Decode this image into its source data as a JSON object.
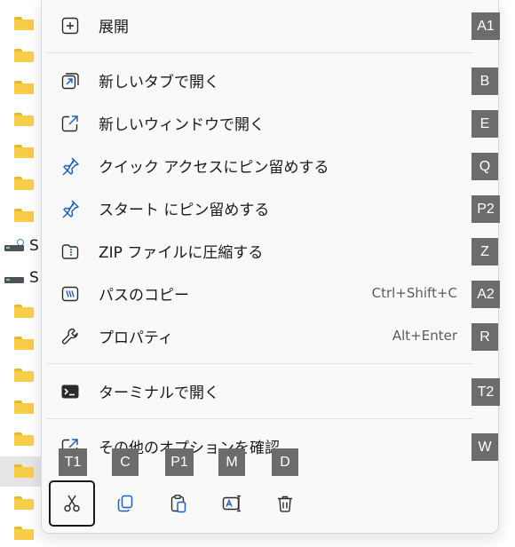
{
  "menu": {
    "items": [
      {
        "label": "展開",
        "shortcut": "",
        "icon": "expand-icon"
      },
      {
        "label": "新しいタブで開く",
        "shortcut": "",
        "icon": "new-tab-icon"
      },
      {
        "label": "新しいウィンドウで開く",
        "shortcut": "",
        "icon": "new-window-icon"
      },
      {
        "label": "クイック アクセスにピン留めする",
        "shortcut": "",
        "icon": "pin-icon"
      },
      {
        "label": "スタート にピン留めする",
        "shortcut": "",
        "icon": "pin-icon"
      },
      {
        "label": "ZIP ファイルに圧縮する",
        "shortcut": "",
        "icon": "zip-icon"
      },
      {
        "label": "パスのコピー",
        "shortcut": "Ctrl+Shift+C",
        "icon": "copy-path-icon"
      },
      {
        "label": "プロパティ",
        "shortcut": "Alt+Enter",
        "icon": "wrench-icon"
      },
      {
        "label": "ターミナルで開く",
        "shortcut": "",
        "icon": "terminal-icon"
      },
      {
        "label": "その他のオプションを確認",
        "shortcut": "",
        "icon": "more-options-icon"
      }
    ],
    "keytips": [
      "A1",
      "B",
      "E",
      "Q",
      "P2",
      "Z",
      "A2",
      "R",
      "T2",
      "W"
    ],
    "toolbar_keytips": [
      "T1",
      "C",
      "P1",
      "M",
      "D"
    ],
    "toolbar": [
      {
        "name": "cut",
        "icon": "scissors-icon"
      },
      {
        "name": "copy",
        "icon": "copy-icon"
      },
      {
        "name": "paste",
        "icon": "paste-icon"
      },
      {
        "name": "rename",
        "icon": "rename-icon"
      },
      {
        "name": "delete",
        "icon": "trash-icon"
      }
    ]
  },
  "tree": {
    "drive1_label": "S",
    "drive2_label": "S"
  },
  "colors": {
    "menu_bg": "#f9f9f9",
    "keytip_bg": "#6c6c6c",
    "icon_accent": "#1f5fbf",
    "folder": "#f7cd4a",
    "selection": "#e5e5e5"
  }
}
